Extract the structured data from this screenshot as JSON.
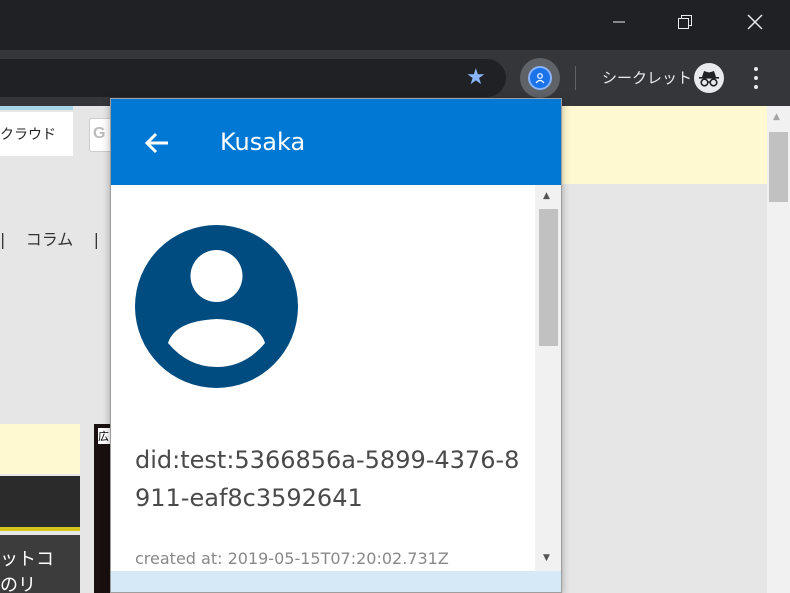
{
  "window": {
    "minimize_icon": "minimize-icon",
    "restore_icon": "restore-icon",
    "close_icon": "close-icon"
  },
  "toolbar": {
    "bookmark_icon": "star-icon",
    "extension_icon": "identity-extension-icon",
    "incognito_label": "シークレット",
    "menu_icon": "more-vert-icon"
  },
  "page": {
    "cloud_button": "クラウド",
    "search_letter": "G",
    "nav_text": "|    コラム    |",
    "gray_box_text": "ットコ\nのリ",
    "thumb_tag": "広"
  },
  "popup": {
    "title": "Kusaka",
    "back_icon": "arrow-back-icon",
    "avatar_icon": "account-circle-icon",
    "did": "did:test:5366856a-5899-4376-8911-eaf8c3592641",
    "created_at": "created at: 2019-05-15T07:20:02.731Z"
  },
  "colors": {
    "header": "#0078d4",
    "avatar": "#004b80",
    "footer": "#d5eaf6"
  }
}
